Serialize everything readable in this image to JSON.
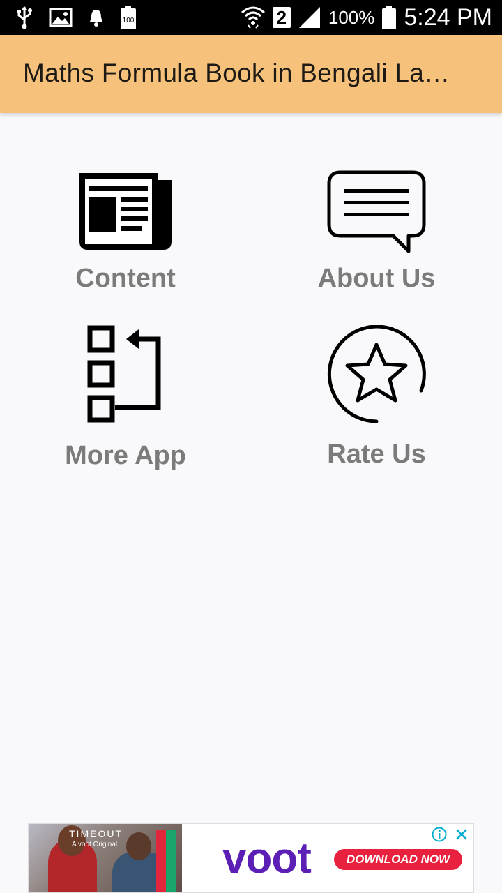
{
  "status_bar": {
    "battery_percent": "100%",
    "time": "5:24 PM",
    "sim_slot": "2",
    "battery_icon_text": "100",
    "icons": [
      "usb-icon",
      "image-icon",
      "notification-bell-icon",
      "battery-saver-icon",
      "wifi-icon",
      "signal-icon",
      "battery-icon"
    ]
  },
  "app_bar": {
    "title": "Maths Formula Book in Bengali Language",
    "background": "#f6c17a"
  },
  "menu": {
    "items": [
      {
        "label": "Content",
        "icon": "newspaper-icon"
      },
      {
        "label": "About Us",
        "icon": "chat-bubble-icon"
      },
      {
        "label": "More App",
        "icon": "more-apps-icon"
      },
      {
        "label": "Rate Us",
        "icon": "star-icon"
      }
    ],
    "label_color": "#7b7b7b"
  },
  "ad": {
    "brand": "voot",
    "cta": "DOWNLOAD NOW",
    "tagline_brand": "TIMEOUT",
    "tagline_sub": "A voot Original",
    "brand_color": "#5b1fb5",
    "cta_color": "#e8213f"
  }
}
